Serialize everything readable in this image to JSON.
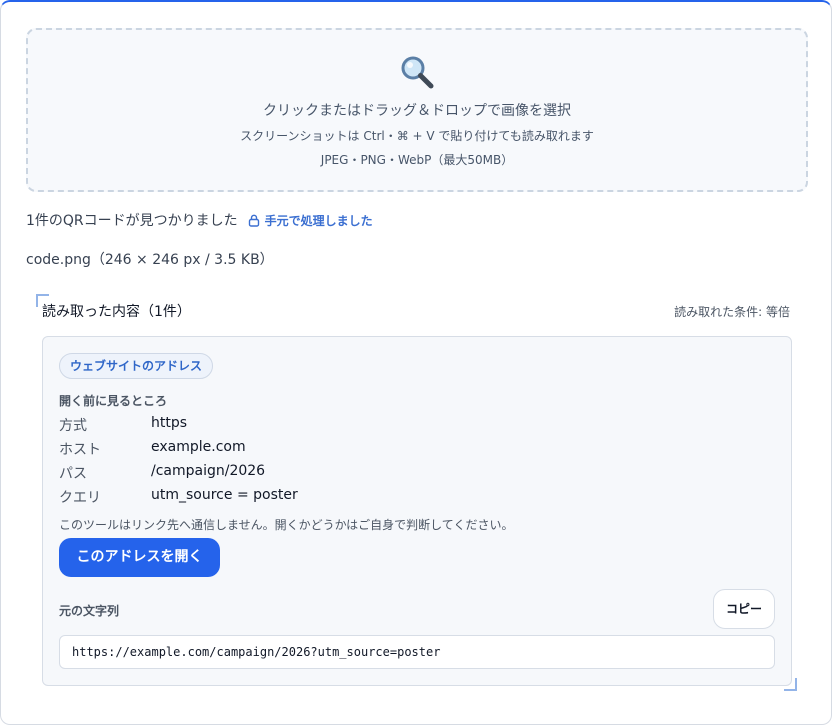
{
  "dropzone": {
    "icon": "magnifier-icon",
    "title": "クリックまたはドラッグ＆ドロップで画像を選択",
    "subtitle": "スクリーンショットは Ctrl・⌘ + V で貼り付けても読み取れます",
    "formats": "JPEG・PNG・WebP（最大50MB）"
  },
  "summary": {
    "found_text": "1件のQRコードが見つかりました",
    "local_badge": "手元で処理しました",
    "local_icon": "lock-icon"
  },
  "file": {
    "info": "code.png（246 × 246 px / 3.5 KB）"
  },
  "results": {
    "title": "読み取った内容（1件）",
    "mode": "読み取れた条件: 等倍",
    "item": {
      "type_badge": "ウェブサイトのアドレス",
      "preview_label": "開く前に見るところ",
      "fields": [
        {
          "key": "方式",
          "value": "https"
        },
        {
          "key": "ホスト",
          "value": "example.com"
        },
        {
          "key": "パス",
          "value": "/campaign/2026"
        },
        {
          "key": "クエリ",
          "value": "utm_source = poster"
        }
      ],
      "notice": "このツールはリンク先へ通信しません。開くかどうかはご自身で判断してください。",
      "open_button": "このアドレスを開く",
      "raw_label": "元の文字列",
      "copy_button": "コピー",
      "raw_value": "https://example.com/campaign/2026?utm_source=poster"
    }
  },
  "colors": {
    "accent": "#2563eb",
    "badge_text": "#2f66c8",
    "border": "#d7dde6"
  }
}
